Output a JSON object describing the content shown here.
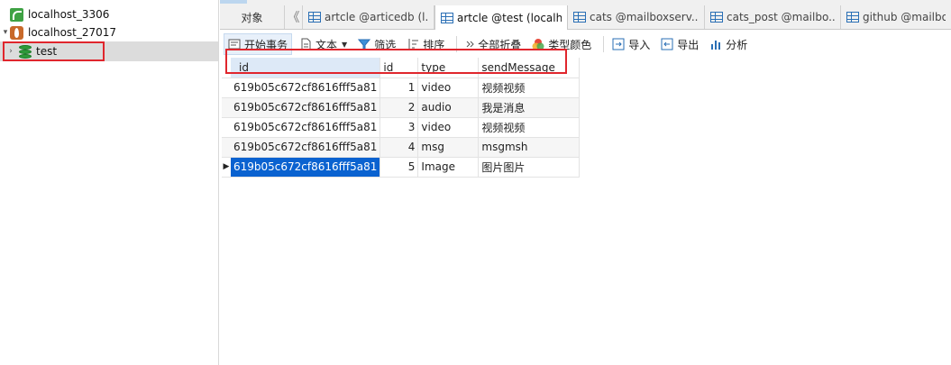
{
  "sidebar": {
    "connections": [
      {
        "label": "localhost_3306",
        "icon": "mysql-icon"
      },
      {
        "label": "localhost_27017",
        "icon": "mongodb-icon"
      }
    ],
    "database": {
      "label": "test",
      "icon": "database-icon"
    }
  },
  "tabs": {
    "objects": "对象",
    "items": [
      {
        "label": "artcle @articedb (l..."
      },
      {
        "label": "artcle @test (localh..."
      },
      {
        "label": "cats @mailboxserv..."
      },
      {
        "label": "cats_post @mailbo..."
      },
      {
        "label": "github @mailbox"
      }
    ]
  },
  "toolbar": {
    "begin_transaction": "开始事务",
    "text": "文本",
    "filter": "筛选",
    "sort": "排序",
    "collapse_all": "全部折叠",
    "type_color": "类型颜色",
    "import": "导入",
    "export": "导出",
    "analyze": "分析"
  },
  "grid": {
    "columns": [
      "_id",
      "id",
      "type",
      "sendMessage"
    ],
    "rows": [
      [
        "619b05c672cf8616fff5a81",
        "1",
        "video",
        "视频视频"
      ],
      [
        "619b05c672cf8616fff5a81",
        "2",
        "audio",
        "我是消息"
      ],
      [
        "619b05c672cf8616fff5a81",
        "3",
        "video",
        "视频视频"
      ],
      [
        "619b05c672cf8616fff5a81",
        "4",
        "msg",
        "msgmsh"
      ],
      [
        "619b05c672cf8616fff5a81",
        "5",
        "Image",
        "图片图片"
      ]
    ]
  },
  "colors": {
    "highlight_box": "#e0262d",
    "selection": "#0a62d0"
  }
}
